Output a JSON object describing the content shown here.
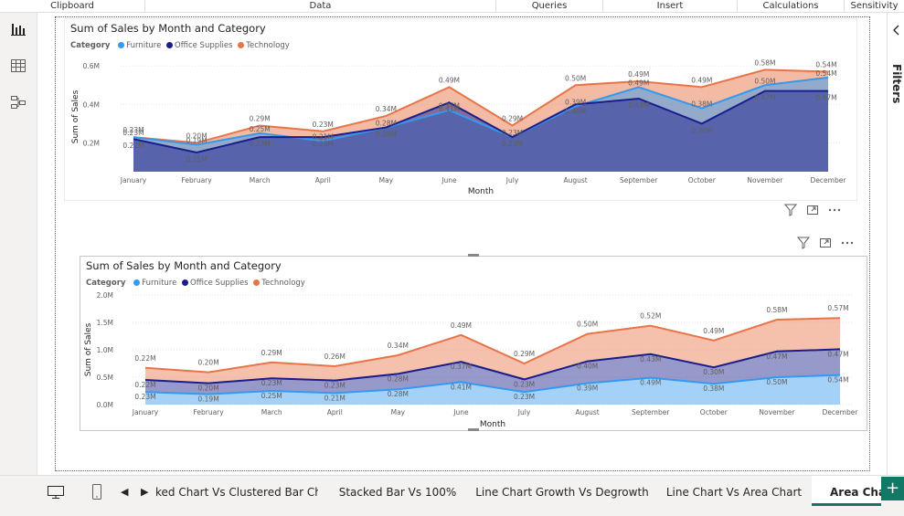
{
  "ribbon": {
    "groups": [
      "Clipboard",
      "Data",
      "Queries",
      "Insert",
      "Calculations",
      "Sensitivity"
    ]
  },
  "colors": {
    "furniture": "#3599f0",
    "office_supplies": "#1a1d8c",
    "technology": "#e8754a",
    "accent": "#117865"
  },
  "leftbar": {
    "icons": [
      "report-view-icon",
      "table-view-icon",
      "model-view-icon"
    ]
  },
  "right_pane": {
    "label": "Filters"
  },
  "visual_header_icons": [
    "filter-icon",
    "focus-mode-icon",
    "more-options-icon"
  ],
  "chart_data": [
    {
      "type": "area",
      "title": "Sum of Sales by Month and Category",
      "legend_title": "Category",
      "xlabel": "Month",
      "ylabel": "Sum of Sales",
      "yticks": [
        "0.2M",
        "0.4M",
        "0.6M"
      ],
      "ylim": [
        0.05,
        0.62
      ],
      "stacked": false,
      "categories": [
        "January",
        "February",
        "March",
        "April",
        "May",
        "June",
        "July",
        "August",
        "September",
        "October",
        "November",
        "December"
      ],
      "series": [
        {
          "name": "Furniture",
          "values": [
            0.23,
            0.19,
            0.25,
            0.21,
            0.28,
            0.37,
            0.23,
            0.39,
            0.49,
            0.38,
            0.5,
            0.54
          ]
        },
        {
          "name": "Office Supplies",
          "values": [
            0.22,
            0.15,
            0.23,
            0.23,
            0.28,
            0.41,
            0.23,
            0.4,
            0.43,
            0.3,
            0.47,
            0.47
          ]
        },
        {
          "name": "Technology",
          "values": [
            0.23,
            0.2,
            0.29,
            0.26,
            0.34,
            0.49,
            0.29,
            0.5,
            0.52,
            0.49,
            0.58,
            0.57
          ]
        }
      ],
      "data_labels": [
        [
          "0.23M",
          "0.19M",
          "0.25M",
          "0.21M",
          "0.28M",
          "0.37M",
          "0.23M",
          "0.39M",
          "0.49M",
          "0.38M",
          "0.50M",
          "0.54M"
        ],
        [
          "0.22M",
          "0.15M",
          "0.23M",
          "0.23M",
          "0.28M",
          "0.41M",
          "0.23M",
          "0.40M",
          "0.43M",
          "0.30M",
          "0.47M",
          "0.47M"
        ],
        [
          "0.23M",
          "0.20M",
          "0.29M",
          "0.23M",
          "0.34M",
          "0.49M",
          "0.29M",
          "0.50M",
          "0.49M",
          "0.49M",
          "0.58M",
          "0.54M"
        ]
      ]
    },
    {
      "type": "area",
      "title": "Sum of Sales by Month and Category",
      "legend_title": "Category",
      "xlabel": "Month",
      "ylabel": "Sum of Sales",
      "yticks": [
        "0.0M",
        "0.5M",
        "1.0M",
        "1.5M",
        "2.0M"
      ],
      "ylim": [
        0,
        2.0
      ],
      "stacked": true,
      "categories": [
        "January",
        "February",
        "March",
        "April",
        "May",
        "June",
        "July",
        "August",
        "September",
        "October",
        "November",
        "December"
      ],
      "series": [
        {
          "name": "Furniture",
          "values": [
            0.23,
            0.19,
            0.25,
            0.21,
            0.28,
            0.41,
            0.23,
            0.39,
            0.49,
            0.38,
            0.5,
            0.54
          ]
        },
        {
          "name": "Office Supplies",
          "values": [
            0.22,
            0.2,
            0.23,
            0.23,
            0.28,
            0.37,
            0.23,
            0.4,
            0.43,
            0.3,
            0.47,
            0.47
          ]
        },
        {
          "name": "Technology",
          "values": [
            0.22,
            0.2,
            0.29,
            0.26,
            0.34,
            0.49,
            0.29,
            0.5,
            0.52,
            0.49,
            0.58,
            0.57
          ]
        }
      ],
      "data_labels": [
        [
          "0.23M",
          "0.19M",
          "0.25M",
          "0.21M",
          "0.28M",
          "0.41M",
          "0.23M",
          "0.39M",
          "0.49M",
          "0.38M",
          "0.50M",
          "0.54M"
        ],
        [
          "0.22M",
          "0.20M",
          "0.23M",
          "0.23M",
          "0.28M",
          "0.37M",
          "0.23M",
          "0.40M",
          "0.43M",
          "0.30M",
          "0.47M",
          "0.47M"
        ],
        [
          "0.22M",
          "0.20M",
          "0.29M",
          "0.26M",
          "0.34M",
          "0.49M",
          "0.29M",
          "0.50M",
          "0.52M",
          "0.49M",
          "0.58M",
          "0.57M"
        ]
      ]
    }
  ],
  "tabs": [
    {
      "label": "ked Chart Vs Clustered Bar Chart",
      "active": false
    },
    {
      "label": "Stacked Bar Vs 100%",
      "active": false
    },
    {
      "label": "Line Chart Growth Vs Degrowth",
      "active": false
    },
    {
      "label": "Line Chart Vs Area Chart",
      "active": false
    },
    {
      "label": "Area Chart",
      "active": true
    }
  ],
  "add_tab_label": "+"
}
